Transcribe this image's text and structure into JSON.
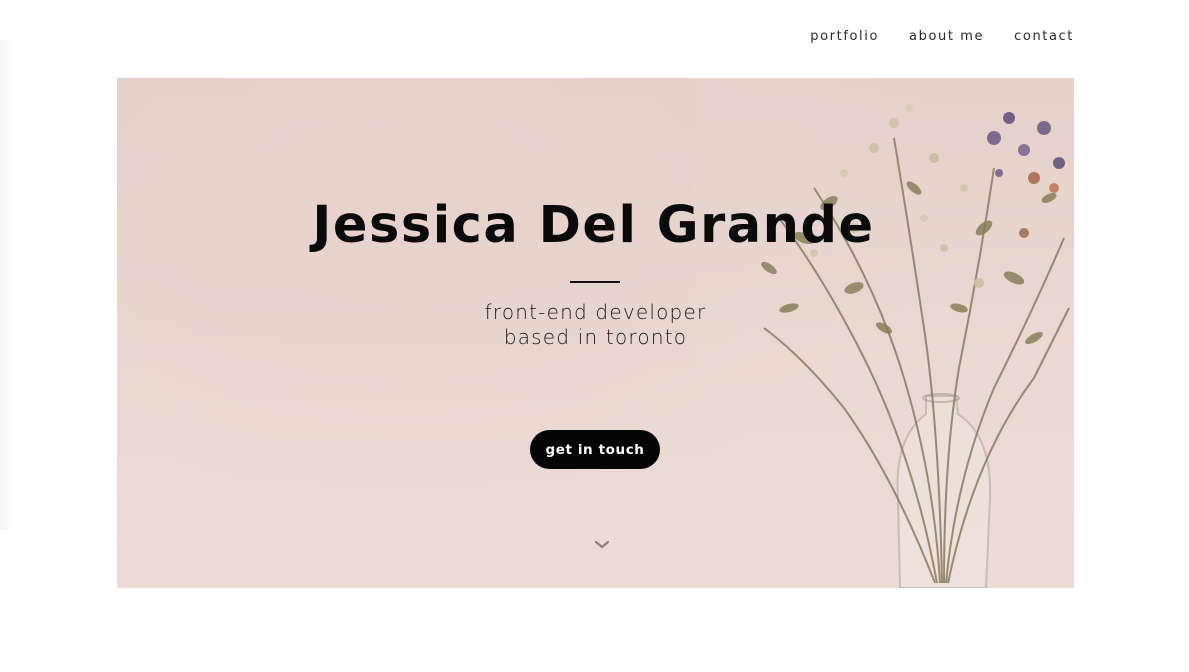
{
  "nav": {
    "items": [
      {
        "label": "portfolio"
      },
      {
        "label": "about me"
      },
      {
        "label": "contact"
      }
    ]
  },
  "hero": {
    "title": "Jessica Del Grande",
    "subtitle_line1": "front-end developer",
    "subtitle_line2": "based in toronto",
    "cta_label": "get in touch",
    "scroll_icon": "chevron-down-icon"
  },
  "colors": {
    "hero_bg": "#e6d3cc",
    "text": "#0a0a0a",
    "button_bg": "#050505",
    "button_text": "#ffffff"
  }
}
